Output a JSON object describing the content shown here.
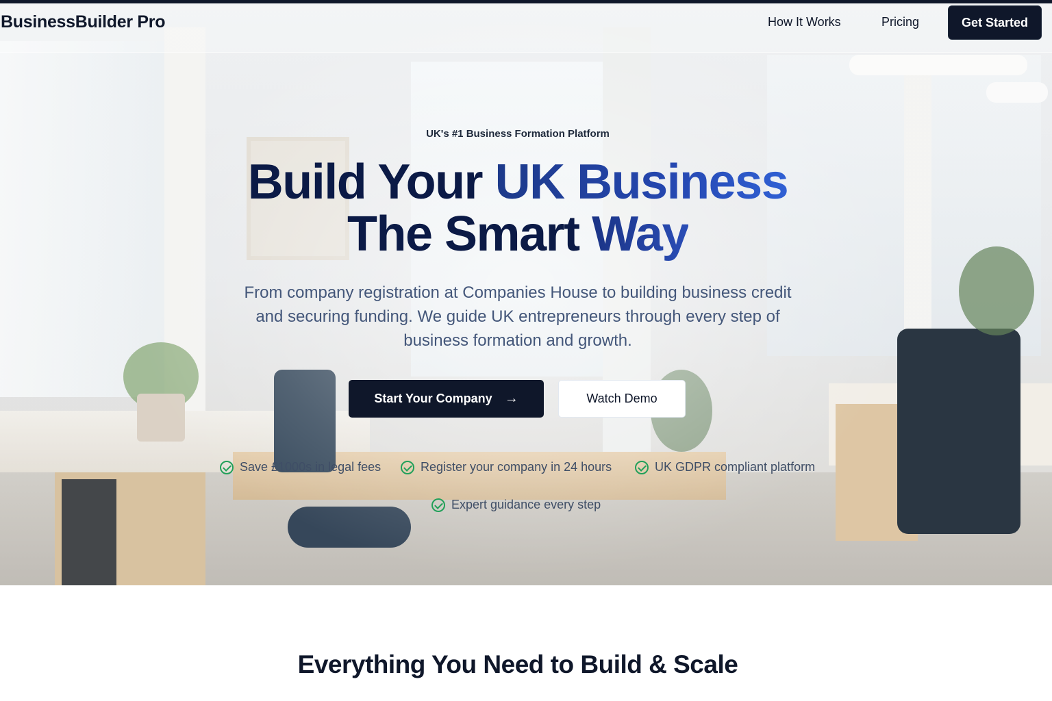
{
  "brand": {
    "name": "BusinessBuilder Pro"
  },
  "nav": {
    "links": [
      {
        "label": "How It Works"
      },
      {
        "label": "Pricing"
      }
    ],
    "cta_label": "Get Started"
  },
  "hero": {
    "eyebrow": "UK's #1 Business Formation Platform",
    "headline": {
      "line1_part1": "Build Your ",
      "line1_part2": "UK Business",
      "line2_part1": "The Smart ",
      "line2_part2": "Way"
    },
    "subtext": "From company registration at Companies House to building business credit and securing funding. We guide UK entrepreneurs through every step of business formation and growth.",
    "primary_cta": {
      "label": "Start Your Company",
      "icon": "arrow-right-icon",
      "arrow": "→"
    },
    "secondary_cta": {
      "label": "Watch Demo"
    },
    "features": [
      {
        "label": "Save £1000s in legal fees",
        "icon": "check-circle-icon"
      },
      {
        "label": "Register your company in 24 hours",
        "icon": "check-circle-icon"
      },
      {
        "label": "UK GDPR compliant platform",
        "icon": "check-circle-icon"
      },
      {
        "label": "Expert guidance every step",
        "icon": "check-circle-icon"
      }
    ]
  },
  "section": {
    "title": "Everything You Need to Build & Scale"
  },
  "colors": {
    "primary": "#0f172a",
    "accent": "#2547b0",
    "check": "#22a05a",
    "subtext": "#44577a"
  }
}
